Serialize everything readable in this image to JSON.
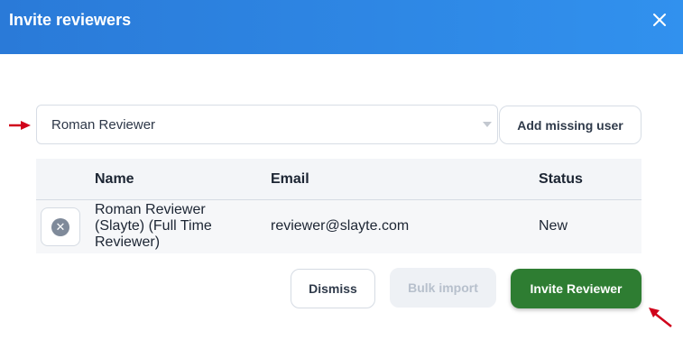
{
  "dialog": {
    "title": "Invite reviewers",
    "close_icon": "close-icon"
  },
  "reviewer_select": {
    "value": "Roman Reviewer",
    "icon": "chevron-down-icon"
  },
  "add_missing_user_label": "Add missing user",
  "table": {
    "headers": {
      "name": "Name",
      "email": "Email",
      "status": "Status"
    },
    "rows": [
      {
        "name_lines": [
          "Roman Reviewer",
          "(Slayte) (Full Time",
          "Reviewer)"
        ],
        "email": "reviewer@slayte.com",
        "status": "New",
        "remove_icon": "remove-circle-icon"
      }
    ]
  },
  "actions": {
    "dismiss_label": "Dismiss",
    "bulk_import_label": "Bulk import",
    "invite_label": "Invite Reviewer"
  },
  "colors": {
    "header": "#2a7ad8",
    "primary": "#2e7d32",
    "annotation_arrow": "#d0021b"
  }
}
